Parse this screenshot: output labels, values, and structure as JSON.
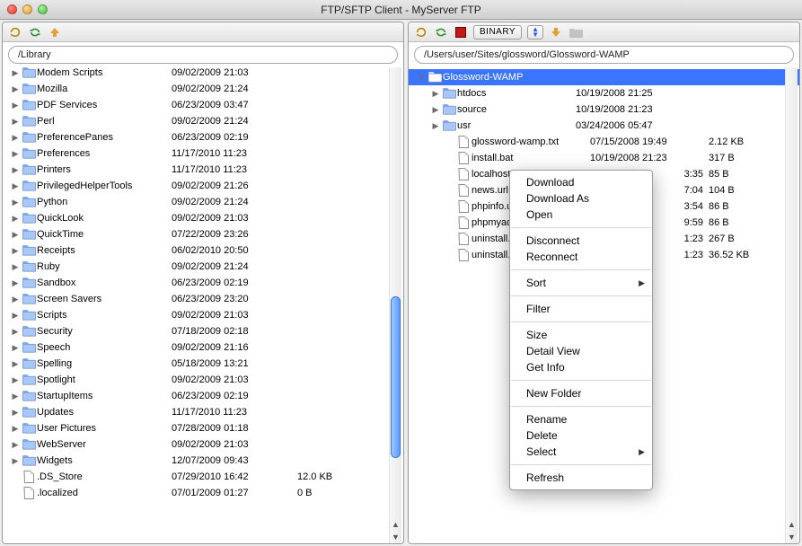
{
  "window": {
    "title": "FTP/SFTP Client - MyServer FTP"
  },
  "left": {
    "path": "/Library",
    "items": [
      {
        "kind": "folder",
        "arrow": true,
        "name": "Modem Scripts",
        "date": "09/02/2009 21:03"
      },
      {
        "kind": "folder",
        "arrow": true,
        "name": "Mozilla",
        "date": "09/02/2009 21:24"
      },
      {
        "kind": "folder",
        "arrow": true,
        "name": "PDF Services",
        "date": "06/23/2009 03:47"
      },
      {
        "kind": "folder",
        "arrow": true,
        "name": "Perl",
        "date": "09/02/2009 21:24"
      },
      {
        "kind": "folder",
        "arrow": true,
        "name": "PreferencePanes",
        "date": "06/23/2009 02:19"
      },
      {
        "kind": "folder",
        "arrow": true,
        "name": "Preferences",
        "date": "11/17/2010 11:23"
      },
      {
        "kind": "folder",
        "arrow": true,
        "name": "Printers",
        "date": "11/17/2010 11:23"
      },
      {
        "kind": "folder",
        "arrow": true,
        "name": "PrivilegedHelperTools",
        "date": "09/02/2009 21:26"
      },
      {
        "kind": "folder",
        "arrow": true,
        "name": "Python",
        "date": "09/02/2009 21:24"
      },
      {
        "kind": "folder",
        "arrow": true,
        "name": "QuickLook",
        "date": "09/02/2009 21:03"
      },
      {
        "kind": "folder",
        "arrow": true,
        "name": "QuickTime",
        "date": "07/22/2009 23:26"
      },
      {
        "kind": "folder",
        "arrow": true,
        "name": "Receipts",
        "date": "06/02/2010 20:50"
      },
      {
        "kind": "folder",
        "arrow": true,
        "name": "Ruby",
        "date": "09/02/2009 21:24"
      },
      {
        "kind": "folder",
        "arrow": true,
        "name": "Sandbox",
        "date": "06/23/2009 02:19"
      },
      {
        "kind": "folder",
        "arrow": true,
        "name": "Screen Savers",
        "date": "06/23/2009 23:20"
      },
      {
        "kind": "folder",
        "arrow": true,
        "name": "Scripts",
        "date": "09/02/2009 21:03"
      },
      {
        "kind": "folder",
        "arrow": true,
        "name": "Security",
        "date": "07/18/2009 02:18"
      },
      {
        "kind": "folder",
        "arrow": true,
        "name": "Speech",
        "date": "09/02/2009 21:16"
      },
      {
        "kind": "folder",
        "arrow": true,
        "name": "Spelling",
        "date": "05/18/2009 13:21"
      },
      {
        "kind": "folder",
        "arrow": true,
        "name": "Spotlight",
        "date": "09/02/2009 21:03"
      },
      {
        "kind": "folder",
        "arrow": true,
        "name": "StartupItems",
        "date": "06/23/2009 02:19"
      },
      {
        "kind": "folder",
        "arrow": true,
        "name": "Updates",
        "date": "11/17/2010 11:23"
      },
      {
        "kind": "folder",
        "arrow": true,
        "name": "User Pictures",
        "date": "07/28/2009 01:18"
      },
      {
        "kind": "folder",
        "arrow": true,
        "name": "WebServer",
        "date": "09/02/2009 21:03"
      },
      {
        "kind": "folder",
        "arrow": true,
        "name": "Widgets",
        "date": "12/07/2009 09:43"
      },
      {
        "kind": "file",
        "arrow": false,
        "name": ".DS_Store",
        "date": "07/29/2010 16:42",
        "size": "12.0 KB"
      },
      {
        "kind": "file",
        "arrow": false,
        "name": ".localized",
        "date": "07/01/2009 01:27",
        "size": "0 B"
      }
    ]
  },
  "right": {
    "path": "/Users/user/Sites/glossword/Glossword-WAMP",
    "mode_label": "BINARY",
    "items": [
      {
        "kind": "folder",
        "arrow": false,
        "indent": 0,
        "name": "Glossword-WAMP",
        "date": "",
        "size": "",
        "selected": true,
        "open": true
      },
      {
        "kind": "folder",
        "arrow": true,
        "indent": 1,
        "name": "htdocs",
        "date": "10/19/2008 21:25",
        "size": ""
      },
      {
        "kind": "folder",
        "arrow": true,
        "indent": 1,
        "name": "source",
        "date": "10/19/2008 21:23",
        "size": ""
      },
      {
        "kind": "folder",
        "arrow": true,
        "indent": 1,
        "name": "usr",
        "date": "03/24/2006 05:47",
        "size": ""
      },
      {
        "kind": "file",
        "arrow": false,
        "indent": 2,
        "name": "glossword-wamp.txt",
        "date": "07/15/2008 19:49",
        "size": "2.12 KB"
      },
      {
        "kind": "file",
        "arrow": false,
        "indent": 2,
        "name": "install.bat",
        "date": "10/19/2008 21:23",
        "size": "317 B"
      },
      {
        "kind": "file",
        "arrow": false,
        "indent": 2,
        "name": "localhost.url",
        "date_suffix": "3:35",
        "size": "85 B"
      },
      {
        "kind": "file",
        "arrow": false,
        "indent": 2,
        "name": "news.url",
        "date_suffix": "7:04",
        "size": "104 B"
      },
      {
        "kind": "file",
        "arrow": false,
        "indent": 2,
        "name": "phpinfo.url",
        "date_suffix": "3:54",
        "size": "86 B"
      },
      {
        "kind": "file",
        "arrow": false,
        "indent": 2,
        "name": "phpmyadmin",
        "date_suffix": "9:59",
        "size": "86 B"
      },
      {
        "kind": "file",
        "arrow": false,
        "indent": 2,
        "name": "uninstall.bat",
        "date_suffix": "1:23",
        "size": "267 B"
      },
      {
        "kind": "file",
        "arrow": false,
        "indent": 2,
        "name": "uninstall.exe",
        "date_suffix": "1:23",
        "size": "36.52 KB"
      }
    ]
  },
  "context_menu": {
    "groups": [
      [
        "Download",
        "Download As",
        "Open"
      ],
      [
        "Disconnect",
        "Reconnect"
      ],
      [
        {
          "label": "Sort",
          "submenu": true
        }
      ],
      [
        "Filter"
      ],
      [
        "Size",
        "Detail View",
        "Get Info"
      ],
      [
        "New Folder"
      ],
      [
        "Rename",
        "Delete",
        {
          "label": "Select",
          "submenu": true
        }
      ],
      [
        "Refresh"
      ]
    ]
  },
  "icons": {
    "refresh": "refresh-icon",
    "sync": "sync-icon",
    "up": "up-icon",
    "stop": "stop-icon",
    "updown": "updown-icon",
    "download": "download-icon",
    "newfolder": "newfolder-icon"
  }
}
